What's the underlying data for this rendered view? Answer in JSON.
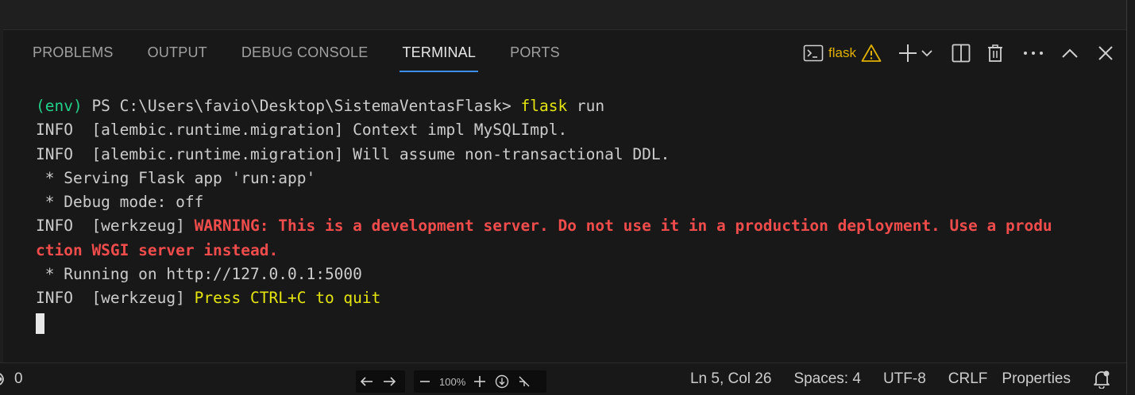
{
  "panel": {
    "tabs": [
      {
        "label": "PROBLEMS",
        "active": false
      },
      {
        "label": "OUTPUT",
        "active": false
      },
      {
        "label": "DEBUG CONSOLE",
        "active": false
      },
      {
        "label": "TERMINAL",
        "active": true
      },
      {
        "label": "PORTS",
        "active": false
      }
    ],
    "terminal_name": "flask"
  },
  "terminal": {
    "prompt_env": "(env)",
    "prompt_path": " PS C:\\Users\\favio\\Desktop\\SistemaVentasFlask> ",
    "prompt_cmd": "flask",
    "prompt_args": " run",
    "info1": "INFO  [alembic.runtime.migration] Context impl MySQLImpl.",
    "info2": "INFO  [alembic.runtime.migration] Will assume non-transactional DDL.",
    "serving": " * Serving Flask app 'run:app'",
    "debug": " * Debug mode: off",
    "warn_prefix": "INFO  [werkzeug] ",
    "warn_text_1": "WARNING: This is a development server. Do not use it in a production deployment. Use a produ",
    "warn_text_2": "ction WSGI server instead.",
    "running": " * Running on http://127.0.0.1:5000",
    "quit_prefix": "INFO  [werkzeug] ",
    "quit_text": "Press CTRL+C to quit"
  },
  "statusbar": {
    "ports_count": "0",
    "position": "Ln 5, Col 26",
    "spaces": "Spaces: 4",
    "encoding": "UTF-8",
    "eol": "CRLF",
    "language": "Properties"
  },
  "zoom": {
    "level": "100%"
  },
  "colors": {
    "accent": "#3b8eea",
    "green": "#23d18b",
    "yellow": "#e5e510",
    "red": "#f14c4c",
    "warning": "#e0b000"
  }
}
